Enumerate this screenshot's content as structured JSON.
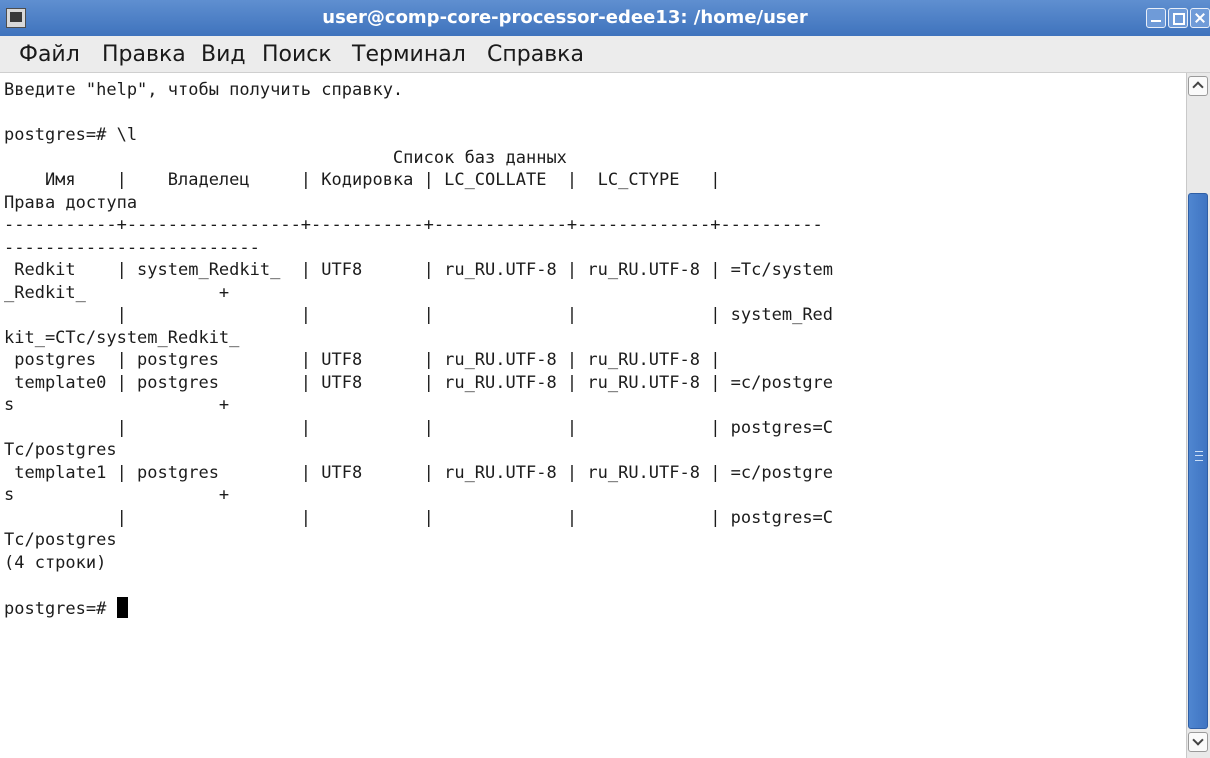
{
  "window": {
    "title": "user@comp-core-processor-edee13: /home/user"
  },
  "menu": [
    "Файл",
    "Правка",
    "Вид",
    "Поиск",
    "Терминал",
    "Справка"
  ],
  "terminal": {
    "lines": [
      "Введите \"help\", чтобы получить справку.",
      "",
      "postgres=# \\l",
      "                                      Список баз данных",
      "    Имя    |    Владелец     | Кодировка | LC_COLLATE  |  LC_CTYPE   |          ",
      "Права доступа",
      "-----------+-----------------+-----------+-------------+-------------+----------",
      "-------------------------",
      " Redkit    | system_Redkit_  | UTF8      | ru_RU.UTF-8 | ru_RU.UTF-8 | =Tc/system",
      "_Redkit_             +",
      "           |                 |           |             |             | system_Red",
      "kit_=CTc/system_Redkit_",
      " postgres  | postgres        | UTF8      | ru_RU.UTF-8 | ru_RU.UTF-8 | ",
      " template0 | postgres        | UTF8      | ru_RU.UTF-8 | ru_RU.UTF-8 | =c/postgre",
      "s                    +",
      "           |                 |           |             |             | postgres=C",
      "Tc/postgres",
      " template1 | postgres        | UTF8      | ru_RU.UTF-8 | ru_RU.UTF-8 | =c/postgre",
      "s                    +",
      "           |                 |           |             |             | postgres=C",
      "Tc/postgres",
      "(4 строки)",
      ""
    ],
    "prompt": "postgres=# "
  }
}
